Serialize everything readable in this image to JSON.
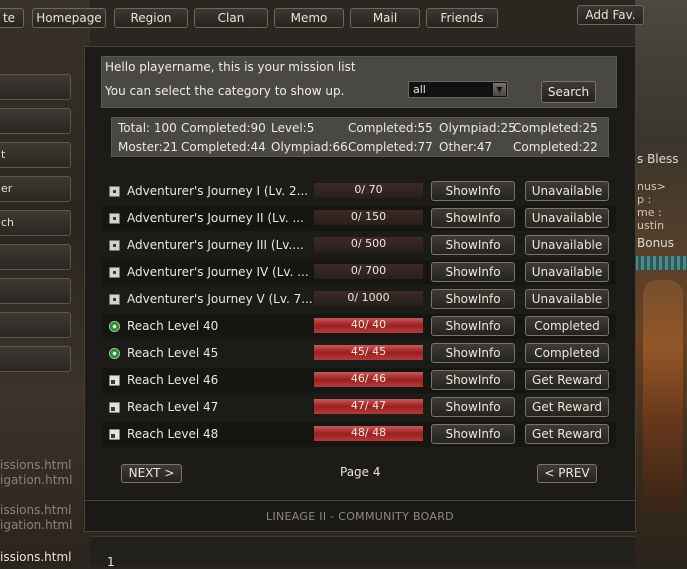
{
  "nav": {
    "items": [
      "te",
      "Homepage",
      "Region",
      "Clan",
      "Memo",
      "Mail",
      "Friends"
    ],
    "add_fav": "Add Fav."
  },
  "side_tabs": [
    "",
    "",
    "t",
    "er",
    "ch",
    "",
    "",
    "",
    ""
  ],
  "background": {
    "bless": "s Bless",
    "minis": [
      "nus>",
      "p  :",
      "me :",
      "ustin"
    ],
    "bonus": "Bonus",
    "left_files": [
      "issions.html",
      "igation.html",
      "",
      "issions.html",
      "igation.html"
    ],
    "left_file_bright": "issions.html",
    "hotbar_num": "1"
  },
  "header": {
    "greeting": "Hello playername, this is your mission list",
    "instruction": "You can select the category to show up.",
    "category_selected": "all",
    "search_label": "Search"
  },
  "stats": {
    "row1": [
      "Total: 100",
      "Completed:90",
      "Level:5",
      "Completed:55",
      "Olympiad:25",
      "Completed:25"
    ],
    "row2": [
      "Moster:21",
      "Completed:44",
      "Olympiad:66",
      "Completed:77",
      "Other:47",
      "Completed:22"
    ]
  },
  "missions": [
    {
      "title": "Adventurer's Journey I (Lv. 2...",
      "progress": "0/ 70",
      "fraction": 0,
      "icon": "lock-icon",
      "show": "ShowInfo",
      "status": "Unavailable"
    },
    {
      "title": "Adventurer's Journey II (Lv. ...",
      "progress": "0/ 150",
      "fraction": 0,
      "icon": "lock-icon",
      "show": "ShowInfo",
      "status": "Unavailable"
    },
    {
      "title": "Adventurer's Journey III (Lv....",
      "progress": "0/ 500",
      "fraction": 0,
      "icon": "lock-icon",
      "show": "ShowInfo",
      "status": "Unavailable"
    },
    {
      "title": "Adventurer's Journey IV (Lv. ...",
      "progress": "0/ 700",
      "fraction": 0,
      "icon": "lock-icon",
      "show": "ShowInfo",
      "status": "Unavailable"
    },
    {
      "title": "Adventurer's Journey V (Lv. 7...",
      "progress": "0/ 1000",
      "fraction": 0,
      "icon": "lock-icon",
      "show": "ShowInfo",
      "status": "Unavailable"
    },
    {
      "title": "Reach Level 40",
      "progress": "40/ 40",
      "fraction": 1,
      "icon": "completed-icon",
      "show": "ShowInfo",
      "status": "Completed"
    },
    {
      "title": "Reach Level 45",
      "progress": "45/ 45",
      "fraction": 1,
      "icon": "completed-icon",
      "show": "ShowInfo",
      "status": "Completed"
    },
    {
      "title": "Reach Level 46",
      "progress": "46/ 46",
      "fraction": 1,
      "icon": "unlock-icon",
      "show": "ShowInfo",
      "status": "Get Reward"
    },
    {
      "title": "Reach Level 47",
      "progress": "47/ 47",
      "fraction": 1,
      "icon": "unlock-icon",
      "show": "ShowInfo",
      "status": "Get Reward"
    },
    {
      "title": "Reach Level 48",
      "progress": "48/ 48",
      "fraction": 1,
      "icon": "unlock-icon",
      "show": "ShowInfo",
      "status": "Get Reward"
    }
  ],
  "pagination": {
    "next": "NEXT >",
    "page": "Page 4",
    "prev": "< PREV"
  },
  "footer": "LINEAGE II - COMMUNITY BOARD"
}
